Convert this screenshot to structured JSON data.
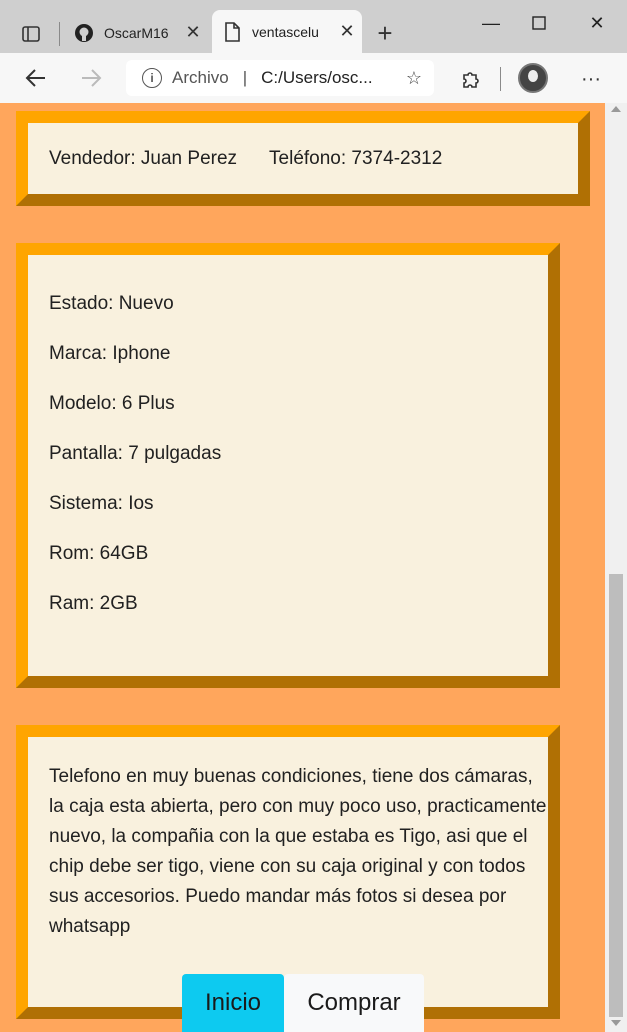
{
  "browser": {
    "tabs": [
      {
        "title": "OscarM16",
        "icon": "github-icon"
      },
      {
        "title": "ventascelu",
        "icon": "page-icon"
      }
    ],
    "address": {
      "scheme_label": "Archivo",
      "separator": "|",
      "url": "C:/Users/osc..."
    }
  },
  "seller": {
    "vendor": "Vendedor: Juan Perez",
    "phone": "Teléfono: 7374-2312"
  },
  "specs": [
    "Estado: Nuevo",
    "Marca: Iphone",
    "Modelo: 6 Plus",
    "Pantalla: 7 pulgadas",
    "Sistema: Ios",
    "Rom: 64GB",
    "Ram: 2GB"
  ],
  "description": "Telefono en muy buenas condiciones, tiene dos cámaras, la caja esta abierta, pero con muy poco uso, practicamente nuevo, la compañia con la que estaba es Tigo, asi que el chip debe ser tigo, viene con su caja original y con todos sus accesorios. Puedo mandar más fotos si desea por whatsapp",
  "buttons": {
    "home": "Inicio",
    "buy": "Comprar"
  },
  "colors": {
    "page_bg": "#ffa65c",
    "card_bg": "#f9f1de",
    "border_light": "#ffa500",
    "border_dark": "#b07004",
    "primary_btn": "#0dcaf0"
  }
}
